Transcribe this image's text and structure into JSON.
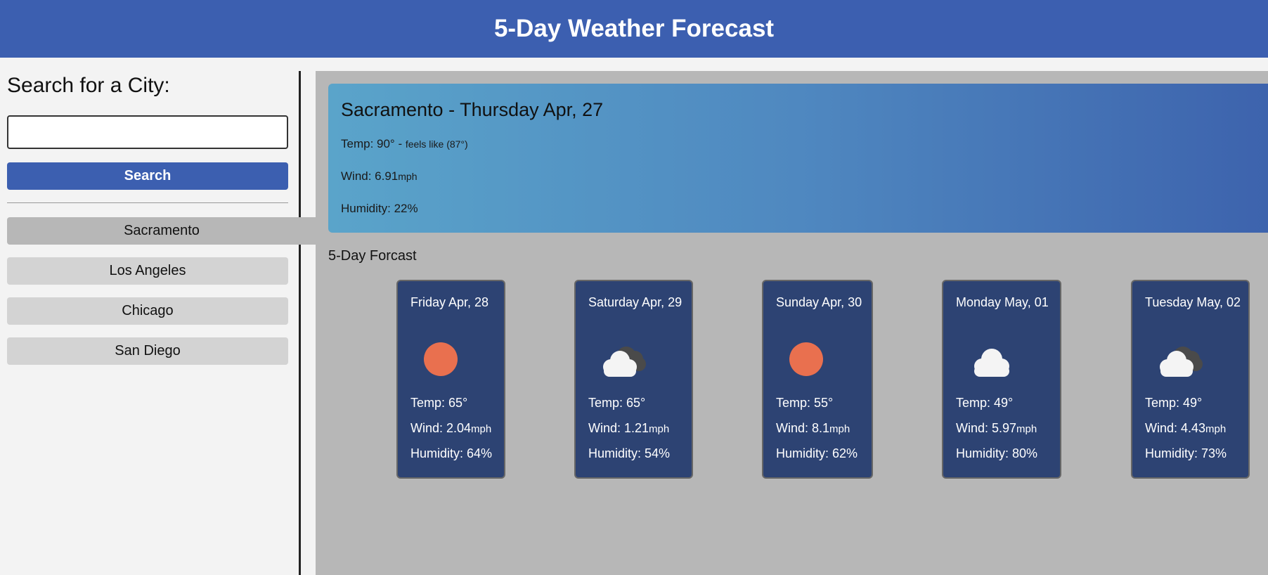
{
  "header": {
    "title": "5-Day Weather Forecast"
  },
  "sidebar": {
    "search_label": "Search for a City:",
    "search_value": "",
    "search_button": "Search",
    "history": [
      "Sacramento",
      "Los Angeles",
      "Chicago",
      "San Diego"
    ],
    "active_city": "Sacramento"
  },
  "current": {
    "title": "Sacramento - Thursday Apr, 27",
    "temp": "Temp: 90° -",
    "feels_like": "feels like (87°)",
    "wind_label": "Wind: 6.91",
    "wind_unit": "mph",
    "humidity": "Humidity: 22%"
  },
  "forecast": {
    "title": "5-Day Forcast",
    "days": [
      {
        "date": "Friday Apr, 28",
        "icon": "sun-icon",
        "temp": "Temp: 65°",
        "wind": "Wind: 2.04",
        "wind_unit": "mph",
        "humidity": "Humidity: 64%"
      },
      {
        "date": "Saturday Apr, 29",
        "icon": "partly-cloudy-icon",
        "temp": "Temp: 65°",
        "wind": "Wind: 1.21",
        "wind_unit": "mph",
        "humidity": "Humidity: 54%"
      },
      {
        "date": "Sunday Apr, 30",
        "icon": "sun-icon",
        "temp": "Temp: 55°",
        "wind": "Wind: 8.1",
        "wind_unit": "mph",
        "humidity": "Humidity: 62%"
      },
      {
        "date": "Monday May, 01",
        "icon": "cloud-icon",
        "temp": "Temp: 49°",
        "wind": "Wind: 5.97",
        "wind_unit": "mph",
        "humidity": "Humidity: 80%"
      },
      {
        "date": "Tuesday May, 02",
        "icon": "partly-cloudy-icon",
        "temp": "Temp: 49°",
        "wind": "Wind: 4.43",
        "wind_unit": "mph",
        "humidity": "Humidity: 73%"
      }
    ]
  },
  "colors": {
    "header": "#3c5fb0",
    "card": "#2d4373",
    "sun": "#e9704f",
    "panel": "#b7b7b7"
  }
}
